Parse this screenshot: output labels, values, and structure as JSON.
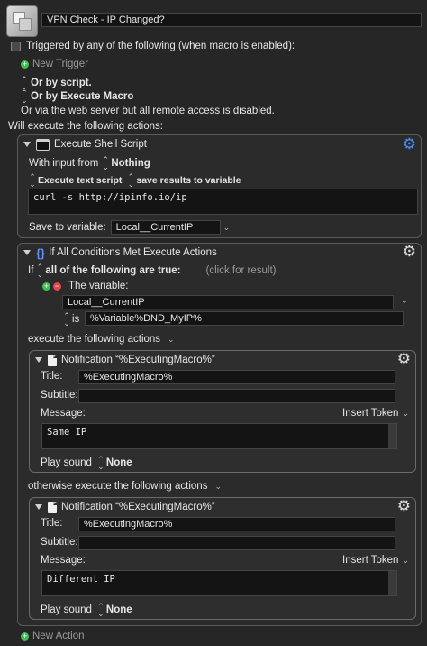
{
  "macro": {
    "name": "VPN Check - IP Changed?"
  },
  "triggers": {
    "triggered_by": "Triggered by any of the following (when macro is enabled):",
    "new_trigger": "New Trigger",
    "or_script": "Or by script.",
    "or_execute": "Or by Execute Macro",
    "web_note": "Or via the web server but all remote access is disabled."
  },
  "actions_header": "Will execute the following actions:",
  "shell": {
    "title": "Execute Shell Script",
    "with_input_label": "With input from",
    "with_input_value": "Nothing",
    "execute_text": "Execute text script",
    "save_results": "save results to variable",
    "code": "curl -s http://ipinfo.io/ip",
    "save_to_label": "Save to variable:",
    "save_to_value": "Local__CurrentIP"
  },
  "ifblock": {
    "title": "If All Conditions Met Execute Actions",
    "if_label": "If",
    "all_following": "all of the following are true:",
    "click_result": "(click for result)",
    "variable_label": "The variable:",
    "variable_value": "Local__CurrentIP",
    "is_label": "is",
    "is_value": "%Variable%DND_MyIP%",
    "execute_following": "execute the following actions",
    "otherwise": "otherwise execute the following actions"
  },
  "notif1": {
    "title": "Notification “%ExecutingMacro%”",
    "title_label": "Title:",
    "title_value": "%ExecutingMacro%",
    "subtitle_label": "Subtitle:",
    "subtitle_value": "",
    "message_label": "Message:",
    "insert_token": "Insert Token",
    "message_value": "Same IP",
    "play_sound_label": "Play sound",
    "play_sound_value": "None"
  },
  "notif2": {
    "title": "Notification “%ExecutingMacro%”",
    "title_label": "Title:",
    "title_value": "%ExecutingMacro%",
    "subtitle_label": "Subtitle:",
    "subtitle_value": "",
    "message_label": "Message:",
    "insert_token": "Insert Token",
    "message_value": "Different IP",
    "play_sound_label": "Play sound",
    "play_sound_value": "None"
  },
  "new_action": "New Action",
  "colors": {
    "background": "#262626",
    "field": "#141414",
    "gear_active": "#4b8cf0",
    "add": "#3fbf4f",
    "remove": "#e0474c"
  },
  "icons": [
    "macro-icon",
    "terminal-icon",
    "braces-icon",
    "document-icon",
    "gear-icon",
    "plus-icon",
    "minus-icon",
    "chevron-down-icon",
    "updown-icon"
  ]
}
